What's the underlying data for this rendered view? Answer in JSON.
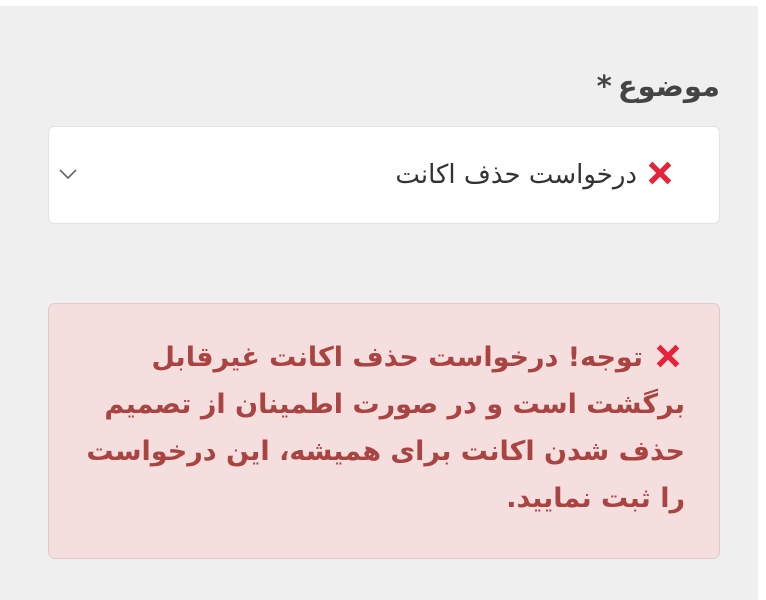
{
  "form": {
    "subject_label": "موضوع",
    "required_mark": "*"
  },
  "select": {
    "selected_value": "درخواست حذف اکانت",
    "icon": "cross-mark-icon",
    "dropdown_icon": "chevron-down-icon"
  },
  "alert": {
    "message": "توجه! درخواست حذف اکانت غیرقابل برگشت است و در صورت اطمینان از تصمیم حذف شدن اکانت برای همیشه، این درخواست را ثبت نمایید.",
    "icon": "cross-mark-icon"
  },
  "colors": {
    "background": "#efefef",
    "alert_background": "#f5dede",
    "alert_text": "#a94442",
    "cross_mark": "#e5243b"
  }
}
